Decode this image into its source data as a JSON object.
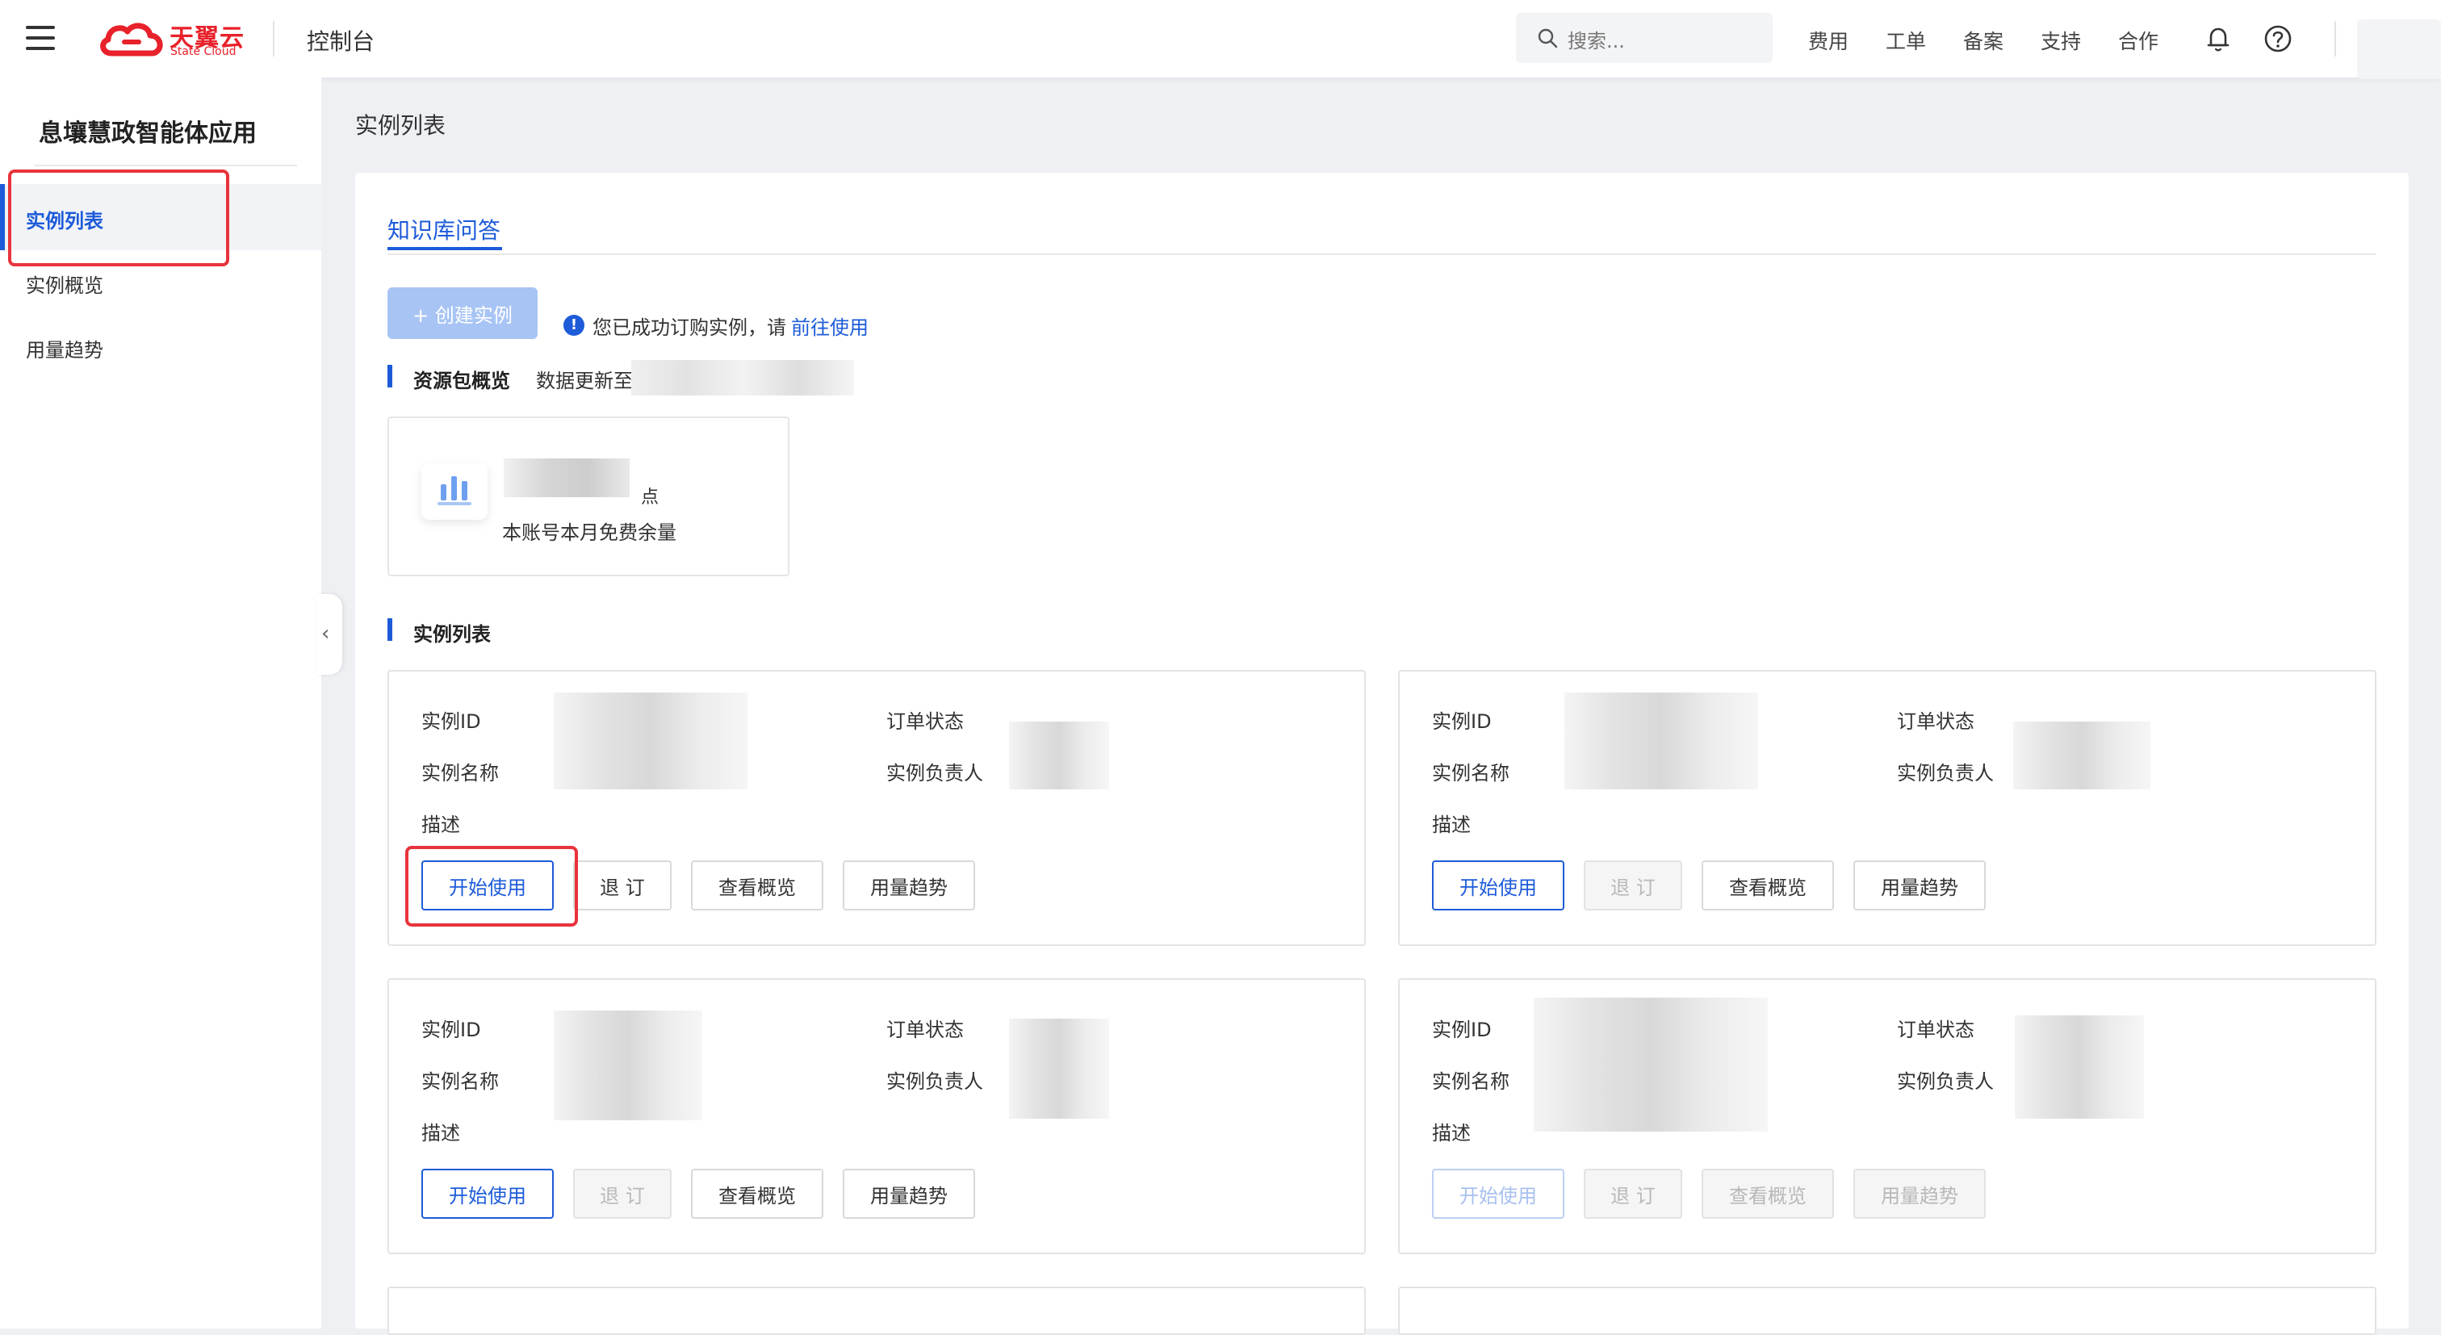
{
  "header": {
    "logo_text": "天翼云",
    "logo_sub": "State Cloud",
    "console_label": "控制台",
    "search_placeholder": "搜索...",
    "nav": [
      "费用",
      "工单",
      "备案",
      "支持",
      "合作"
    ]
  },
  "sidebar": {
    "title": "息壤慧政智能体应用",
    "items": [
      {
        "label": "实例列表",
        "active": true
      },
      {
        "label": "实例概览",
        "active": false
      },
      {
        "label": "用量趋势",
        "active": false
      }
    ]
  },
  "page": {
    "title": "实例列表",
    "tab": "知识库问答",
    "create_button": "+ 创建实例",
    "info_text": "您已成功订购实例，请",
    "info_link": "前往使用",
    "resource_section": "资源包概览",
    "data_update_label": "数据更新至",
    "resource_unit": "点",
    "resource_label": "本账号本月免费余量",
    "instance_section": "实例列表"
  },
  "card_labels": {
    "id": "实例ID",
    "name": "实例名称",
    "desc": "描述",
    "order_status": "订单状态",
    "owner": "实例负责人"
  },
  "buttons": {
    "start": "开始使用",
    "unsubscribe": "退 订",
    "overview": "查看概览",
    "trend": "用量趋势"
  },
  "colors": {
    "primary": "#1d5bd9",
    "highlight": "#e8333c",
    "brand_red": "#e8212a"
  }
}
